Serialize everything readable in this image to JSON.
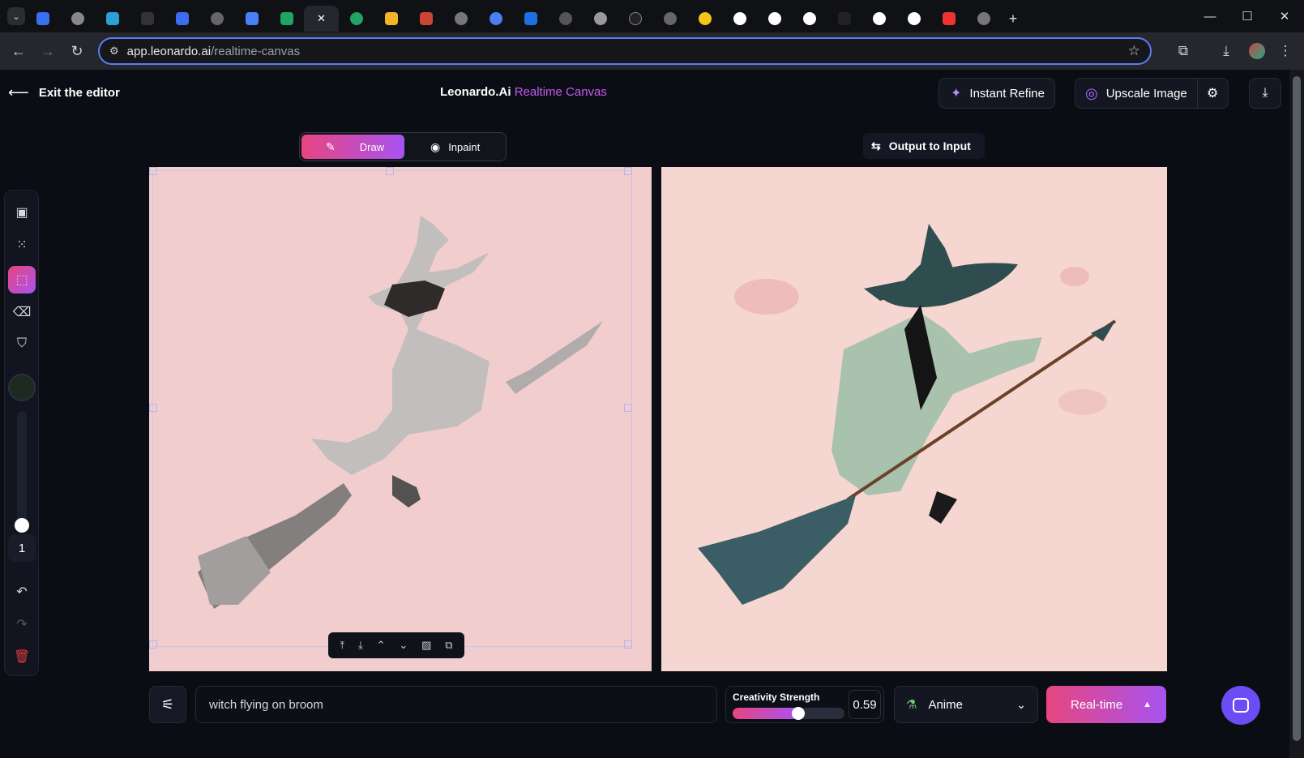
{
  "browser": {
    "tabs_count_hint": "",
    "url_domain": "app.leonardo.ai",
    "url_path": "/realtime-canvas"
  },
  "header": {
    "exit_label": "Exit the editor",
    "brand": "Leonardo.Ai",
    "product": "Realtime Canvas",
    "instant_refine_label": "Instant Refine",
    "upscale_label": "Upscale Image"
  },
  "modes": {
    "draw_label": "Draw",
    "inpaint_label": "Inpaint",
    "active": "Draw"
  },
  "output_to_input_label": "Output to Input",
  "toolbar": {
    "brush_size": "1",
    "brush_color": "#1c2a20"
  },
  "bottom": {
    "prompt_text": "witch flying on broom",
    "creativity_label": "Creativity Strength",
    "creativity_value": "0.59",
    "creativity_fraction": 0.59,
    "style_label": "Anime",
    "realtime_label": "Real-time"
  },
  "colors": {
    "accent_pink": "#e7457f",
    "accent_purple": "#a853f0",
    "canvas_left_bg": "#f2cdcd",
    "canvas_right_bg": "#f6d6d0",
    "app_bg": "#0b0d14"
  }
}
